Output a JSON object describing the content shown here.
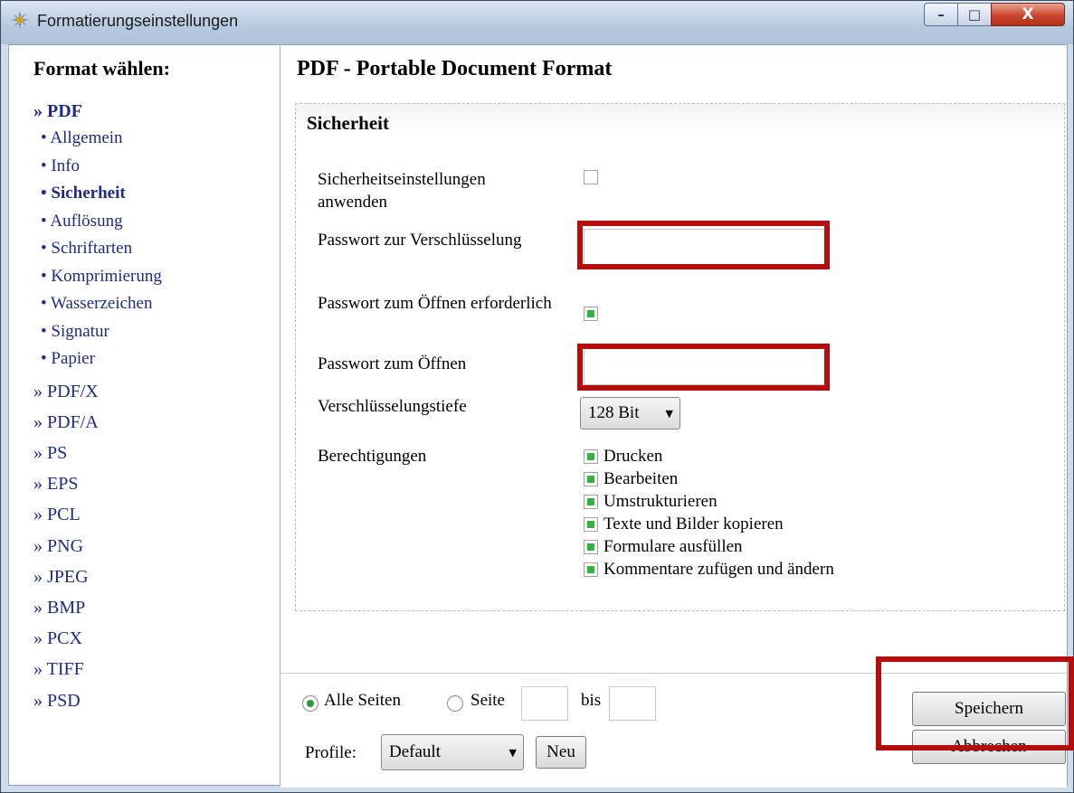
{
  "window": {
    "title": "Formatierungseinstellungen",
    "min_glyph": "–",
    "max_glyph": "□",
    "close_glyph": "X"
  },
  "sidebar": {
    "heading": "Format wählen:",
    "active_group": "» PDF",
    "sub_items": [
      {
        "label": "• Allgemein"
      },
      {
        "label": "• Info"
      },
      {
        "label": "• Sicherheit",
        "active": true
      },
      {
        "label": "• Auflösung"
      },
      {
        "label": "• Schriftarten"
      },
      {
        "label": "• Komprimierung"
      },
      {
        "label": "• Wasserzeichen"
      },
      {
        "label": "• Signatur"
      },
      {
        "label": "• Papier"
      }
    ],
    "groups": [
      "» PDF/X",
      "» PDF/A",
      "» PS",
      "» EPS",
      "» PCL",
      "» PNG",
      "» JPEG",
      "» BMP",
      "» PCX",
      "» TIFF",
      "» PSD"
    ]
  },
  "main": {
    "title": "PDF - Portable Document Format",
    "section_title": "Sicherheit",
    "fields": {
      "apply_security_label": "Sicherheitseinstellungen anwenden",
      "apply_security_checked": false,
      "encryption_password_label": "Passwort zur Verschlüsselung",
      "encryption_password_value": "",
      "open_password_required_label": "Passwort zum Öffnen erforderlich",
      "open_password_required_checked": true,
      "open_password_label": "Passwort zum Öffnen",
      "open_password_value": "",
      "encryption_depth_label": "Verschlüsselungstiefe",
      "encryption_depth_value": "128 Bit",
      "permissions_label": "Berechtigungen"
    },
    "permissions": [
      {
        "label": "Drucken",
        "checked": true
      },
      {
        "label": "Bearbeiten",
        "checked": true
      },
      {
        "label": "Umstrukturieren",
        "checked": true
      },
      {
        "label": "Texte und Bilder kopieren",
        "checked": true
      },
      {
        "label": "Formulare ausfüllen",
        "checked": true
      },
      {
        "label": "Kommentare zufügen und ändern",
        "checked": true
      }
    ]
  },
  "bottom": {
    "all_pages_label": "Alle Seiten",
    "page_label": "Seite",
    "to_label": "bis",
    "page_from_value": "",
    "page_to_value": "",
    "profile_label": "Profile:",
    "profile_value": "Default",
    "new_button": "Neu",
    "save_button": "Speichern",
    "cancel_button": "Abbrechen"
  },
  "colors": {
    "highlight": "#b30e0e",
    "checkbox_fill": "#2fb53c",
    "nav_link": "#1f2a8a"
  }
}
